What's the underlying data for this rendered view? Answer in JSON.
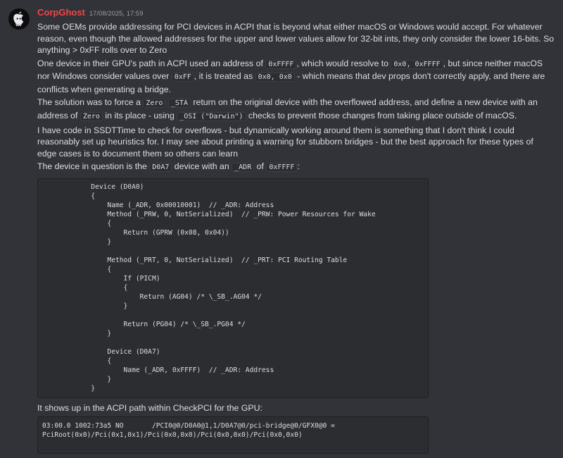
{
  "message": {
    "author": "CorpGhost",
    "timestamp": "17/08/2025, 17:59",
    "para1": "Some OEMs provide addressing for PCI devices in ACPI that is beyond what either macOS or Windows would accept.  For whatever reason, even though the allowed addresses for the upper and lower values allow for 32-bit ints, they only consider the lower 16-bits.  So anything > 0xFF rolls over to Zero",
    "para2": {
      "t1": "One device in their GPU's path in ACPI used an address of ",
      "c1": "0xFFFF",
      "t2": ", which would resolve to ",
      "c2": "0x0, 0xFFFF",
      "t3": ", but since neither macOS nor Windows consider values over ",
      "c3": "0xFF",
      "t4": ", it is treated as ",
      "c4": "0x0, 0x0",
      "t5": " - which means that dev props don't correctly apply, and there are conflicts when generating a bridge."
    },
    "para3": {
      "t1": "The solution was to force a ",
      "c1": "Zero",
      "c2": "_STA",
      "t2": " return on the original device with the overflowed address, and define a new device with an address of ",
      "c3": "Zero",
      "t3": " in its place - using ",
      "c4": "_OSI (\"Darwin\")",
      "t4": " checks to prevent those changes from taking place outside of macOS."
    },
    "para4": "I have code in SSDTTime to check for overflows - but dynamically working around them is something that I don't think I could reasonably set up heuristics for.  I may see about printing a warning for stubborn bridges - but the best approach for these types of edge cases is to document them so others can learn",
    "para5": {
      "t1": "The device in question is the ",
      "c1": "D0A7",
      "t2": " device with an ",
      "c2": "_ADR",
      "t3": " of ",
      "c3": "0xFFFF",
      "t4": ":"
    },
    "code_block_1": "            Device (D0A0)\n            {\n                Name (_ADR, 0x00010001)  // _ADR: Address\n                Method (_PRW, 0, NotSerialized)  // _PRW: Power Resources for Wake\n                {\n                    Return (GPRW (0x08, 0x04))\n                }\n\n                Method (_PRT, 0, NotSerialized)  // _PRT: PCI Routing Table\n                {\n                    If (PICM)\n                    {\n                        Return (AG04) /* \\_SB_.AG04 */\n                    }\n\n                    Return (PG04) /* \\_SB_.PG04 */\n                }\n\n                Device (D0A7)\n                {\n                    Name (_ADR, 0xFFFF)  // _ADR: Address\n                }\n            }",
    "para6": "It shows up in the ACPI path within CheckPCI for the GPU:",
    "code_block_2": "03:00.0 1002:73a5 NO       /PCI0@0/D0A0@1,1/D0A7@0/pci-bridge@0/GFX0@0 =\nPciRoot(0x0)/Pci(0x1,0x1)/Pci(0x0,0x0)/Pci(0x0,0x0)/Pci(0x0,0x0)"
  }
}
